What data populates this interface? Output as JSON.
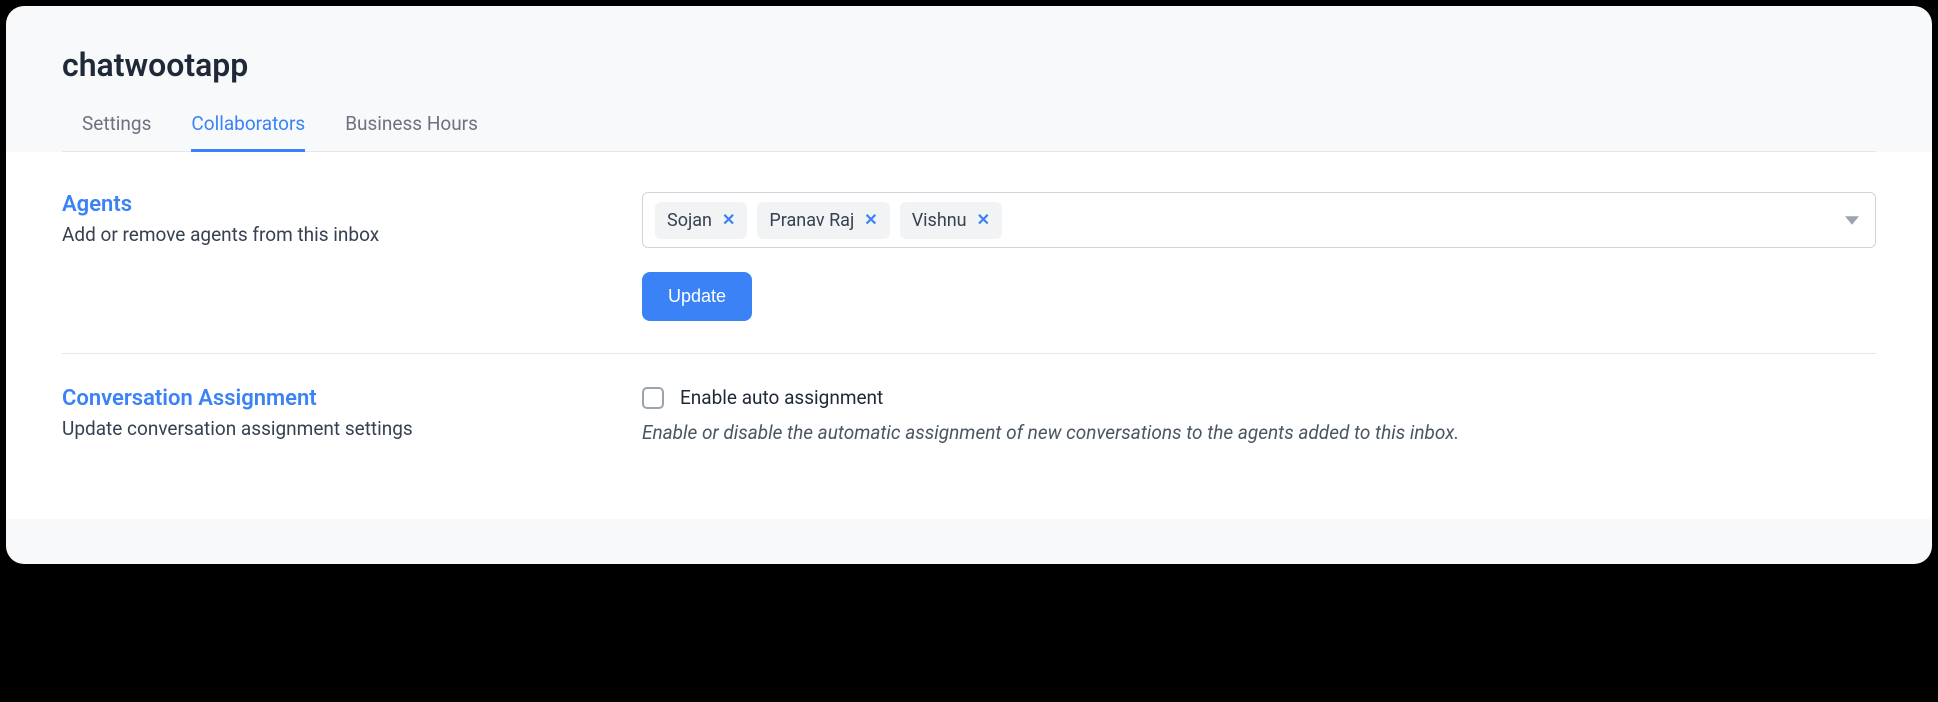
{
  "page_title": "chatwootapp",
  "tabs": [
    {
      "label": "Settings",
      "active": false
    },
    {
      "label": "Collaborators",
      "active": true
    },
    {
      "label": "Business Hours",
      "active": false
    }
  ],
  "agents_section": {
    "title": "Agents",
    "description": "Add or remove agents from this inbox",
    "selected_agents": [
      "Sojan",
      "Pranav Raj",
      "Vishnu"
    ],
    "update_button": "Update"
  },
  "assignment_section": {
    "title": "Conversation Assignment",
    "description": "Update conversation assignment settings",
    "checkbox_label": "Enable auto assignment",
    "checkbox_checked": false,
    "help_text": "Enable or disable the automatic assignment of new conversations to the agents added to this inbox."
  }
}
